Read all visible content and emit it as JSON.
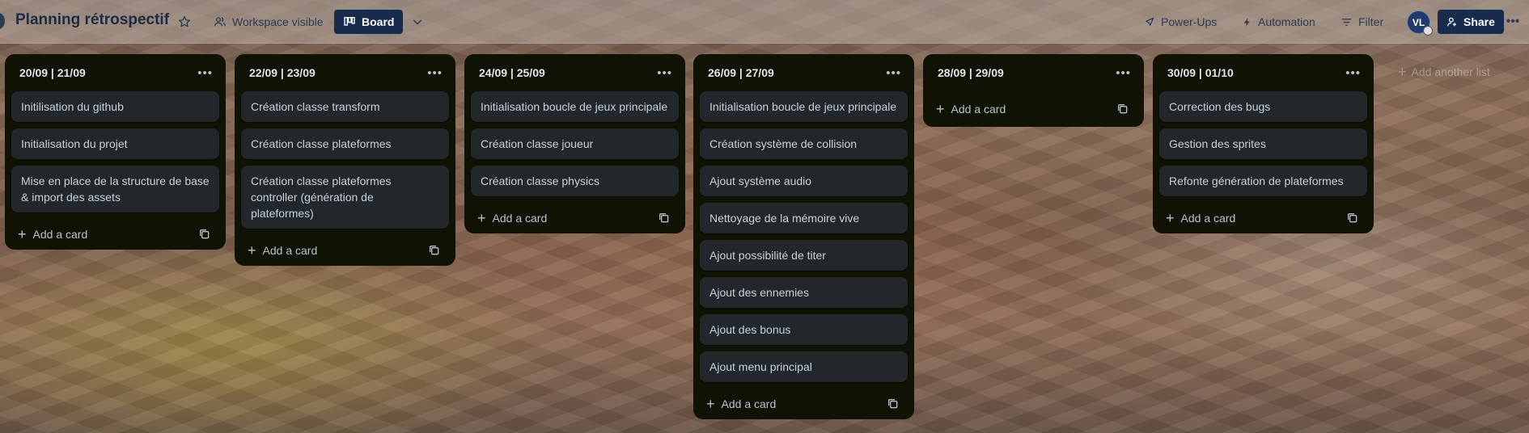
{
  "header": {
    "board_title": "Planning rétrospectif",
    "visibility_label": "Workspace visible",
    "board_view_label": "Board",
    "powerups_label": "Power-Ups",
    "automation_label": "Automation",
    "filter_label": "Filter",
    "avatar_initials": "VL",
    "share_label": "Share"
  },
  "lists": [
    {
      "title": "20/09 | 21/09",
      "cards": [
        "Initilisation du github",
        "Initialisation du projet",
        "Mise en place de la structure de base & import des assets"
      ],
      "add_card_label": "Add a card"
    },
    {
      "title": "22/09 | 23/09",
      "cards": [
        "Création classe transform",
        "Création classe plateformes",
        "Création classe plateformes controller (génération de plateformes)"
      ],
      "add_card_label": "Add a card"
    },
    {
      "title": "24/09 | 25/09",
      "cards": [
        "Initialisation boucle de jeux principale",
        "Création classe joueur",
        "Création classe physics"
      ],
      "add_card_label": "Add a card"
    },
    {
      "title": "26/09 | 27/09",
      "cards": [
        "Initialisation boucle de jeux principale",
        "Création système de collision",
        "Ajout système audio",
        "Nettoyage de la mémoire vive",
        "Ajout possibilité de titer",
        "Ajout des ennemies",
        "Ajout des bonus",
        "Ajout menu principal"
      ],
      "add_card_label": "Add a card"
    },
    {
      "title": "28/09 | 29/09",
      "cards": [],
      "add_card_label": "Add a card"
    },
    {
      "title": "30/09 | 01/10",
      "cards": [
        "Correction des bugs",
        "Gestion des sprites",
        "Refonte génération de plateformes"
      ],
      "add_card_label": "Add a card"
    }
  ],
  "add_list_label": "Add another list",
  "icons": {
    "star": "star-icon",
    "visibility": "people-icon",
    "board": "board-icon",
    "chevron": "chevron-down-icon",
    "powerups": "rocket-icon",
    "automation": "lightning-icon",
    "filter": "filter-icon",
    "share": "add-person-icon",
    "more": "more-icon",
    "template": "template-icon"
  },
  "colors": {
    "header_text": "#1d2b44",
    "primary_button": "#172b4d",
    "list_bg": "#101204",
    "card_bg": "#22272b"
  }
}
